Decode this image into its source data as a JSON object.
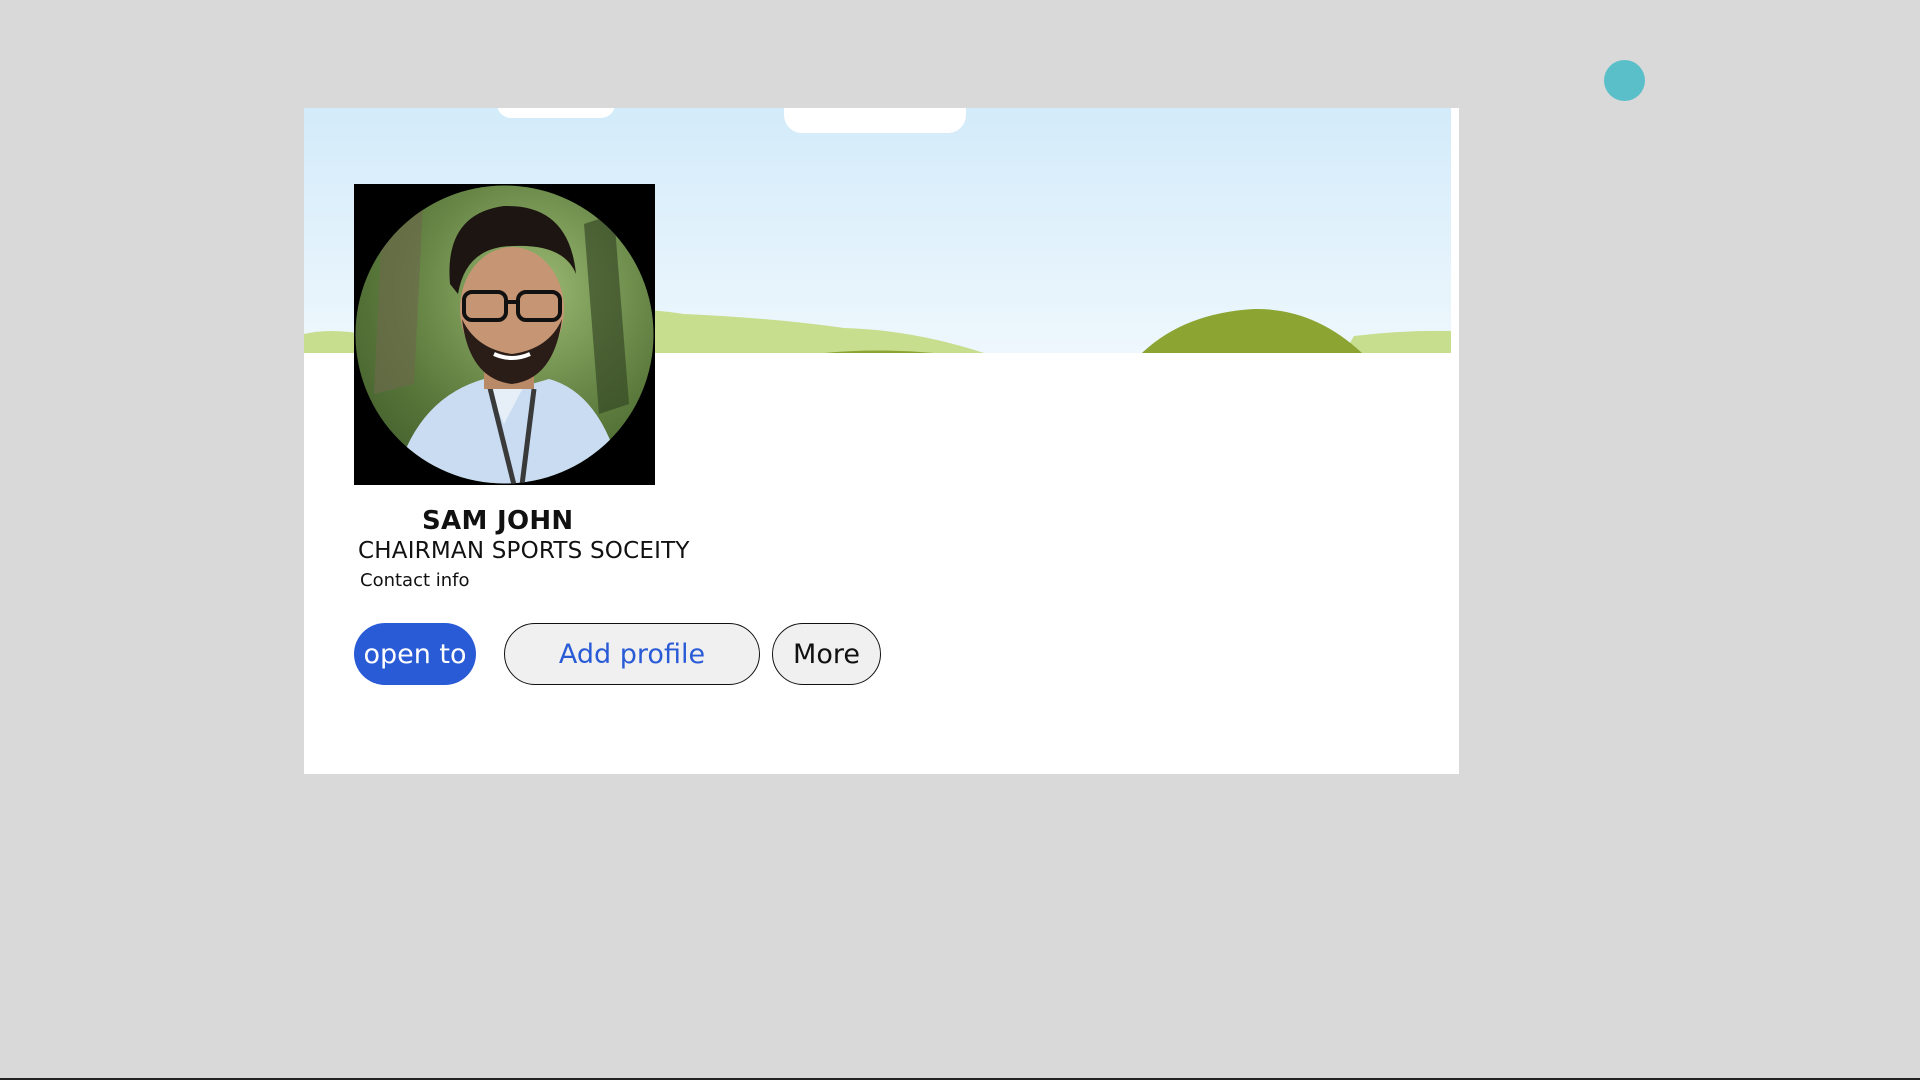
{
  "profile": {
    "name": "SAM JOHN",
    "headline": "CHAIRMAN SPORTS SOCEITY",
    "contact_label": "Contact info"
  },
  "actions": {
    "open_to_label": "open to",
    "add_profile_label": "Add profile",
    "more_label": "More"
  },
  "icons": {
    "status_dot": "teal-dot-icon",
    "avatar": "profile-photo"
  },
  "colors": {
    "page_background": "#d9d9d9",
    "card_background": "#ffffff",
    "primary_button": "#2a5bd7",
    "link_text": "#2a5bd7",
    "accent_dot": "#5bbfca",
    "sky_top": "#d3ebfa",
    "sky_bottom": "#eef7fd",
    "hill_light": "#c7de8e",
    "hill_dark": "#8ca532"
  }
}
